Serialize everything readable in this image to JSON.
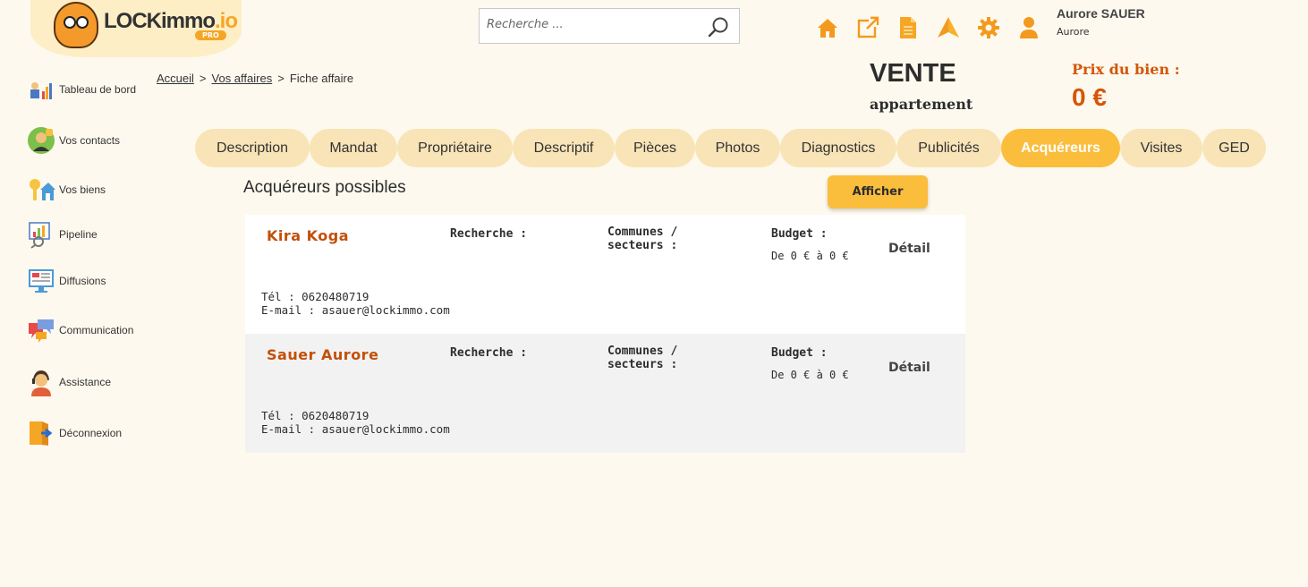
{
  "header": {
    "logo_text": "LOCKimmo",
    "logo_suffix": ".io",
    "logo_badge": "PRO",
    "search_placeholder": "Recherche ...",
    "icons": [
      "home-icon",
      "external-link-icon",
      "document-icon",
      "paper-plane-icon",
      "gear-icon"
    ],
    "user": {
      "name": "Aurore SAUER",
      "sub": "Aurore"
    }
  },
  "sidebar": {
    "items": [
      {
        "label": "Tableau de bord",
        "icon": "dashboard-icon"
      },
      {
        "label": "Vos contacts",
        "icon": "contacts-icon"
      },
      {
        "label": "Vos biens",
        "icon": "properties-icon"
      },
      {
        "label": "Pipeline",
        "icon": "pipeline-icon"
      },
      {
        "label": "Diffusions",
        "icon": "diffusion-icon"
      },
      {
        "label": "Communication",
        "icon": "communication-icon"
      },
      {
        "label": "Assistance",
        "icon": "assistance-icon"
      },
      {
        "label": "Déconnexion",
        "icon": "logout-icon"
      }
    ]
  },
  "breadcrumb": {
    "home": "Accueil",
    "affaires": "Vos affaires",
    "current": "Fiche affaire",
    "sep": ">"
  },
  "deal": {
    "type": "VENTE",
    "subtype": "appartement",
    "price_label": "Prix du bien :",
    "price_value": "0 €"
  },
  "tabs": [
    {
      "label": "Description",
      "active": false
    },
    {
      "label": "Mandat",
      "active": false
    },
    {
      "label": "Propriétaire",
      "active": false
    },
    {
      "label": "Descriptif",
      "active": false
    },
    {
      "label": "Pièces",
      "active": false
    },
    {
      "label": "Photos",
      "active": false
    },
    {
      "label": "Diagnostics",
      "active": false
    },
    {
      "label": "Publicités",
      "active": false
    },
    {
      "label": "Acquéreurs",
      "active": true
    },
    {
      "label": "Visites",
      "active": false
    },
    {
      "label": "GED",
      "active": false
    }
  ],
  "section": {
    "title": "Acquéreurs possibles",
    "show_button": "Afficher"
  },
  "labels": {
    "recherche": "Recherche :",
    "communes": "Communes /",
    "secteurs": "secteurs :",
    "budget": "Budget :",
    "detail": "Détail"
  },
  "buyers": [
    {
      "name": "Kira Koga",
      "budget": "De 0 € à 0 €",
      "tel": "Tél : 0620480719",
      "email": "E-mail : asauer@lockimmo.com"
    },
    {
      "name": "Sauer Aurore",
      "budget": "De 0 € à 0 €",
      "tel": "Tél : 0620480719",
      "email": "E-mail : asauer@lockimmo.com"
    }
  ],
  "colors": {
    "background": "#fef9ee",
    "accent": "#f5a623",
    "tab_inactive": "#f8e4b7",
    "tab_active": "#fbbd3c",
    "name_color": "#c2500a"
  }
}
